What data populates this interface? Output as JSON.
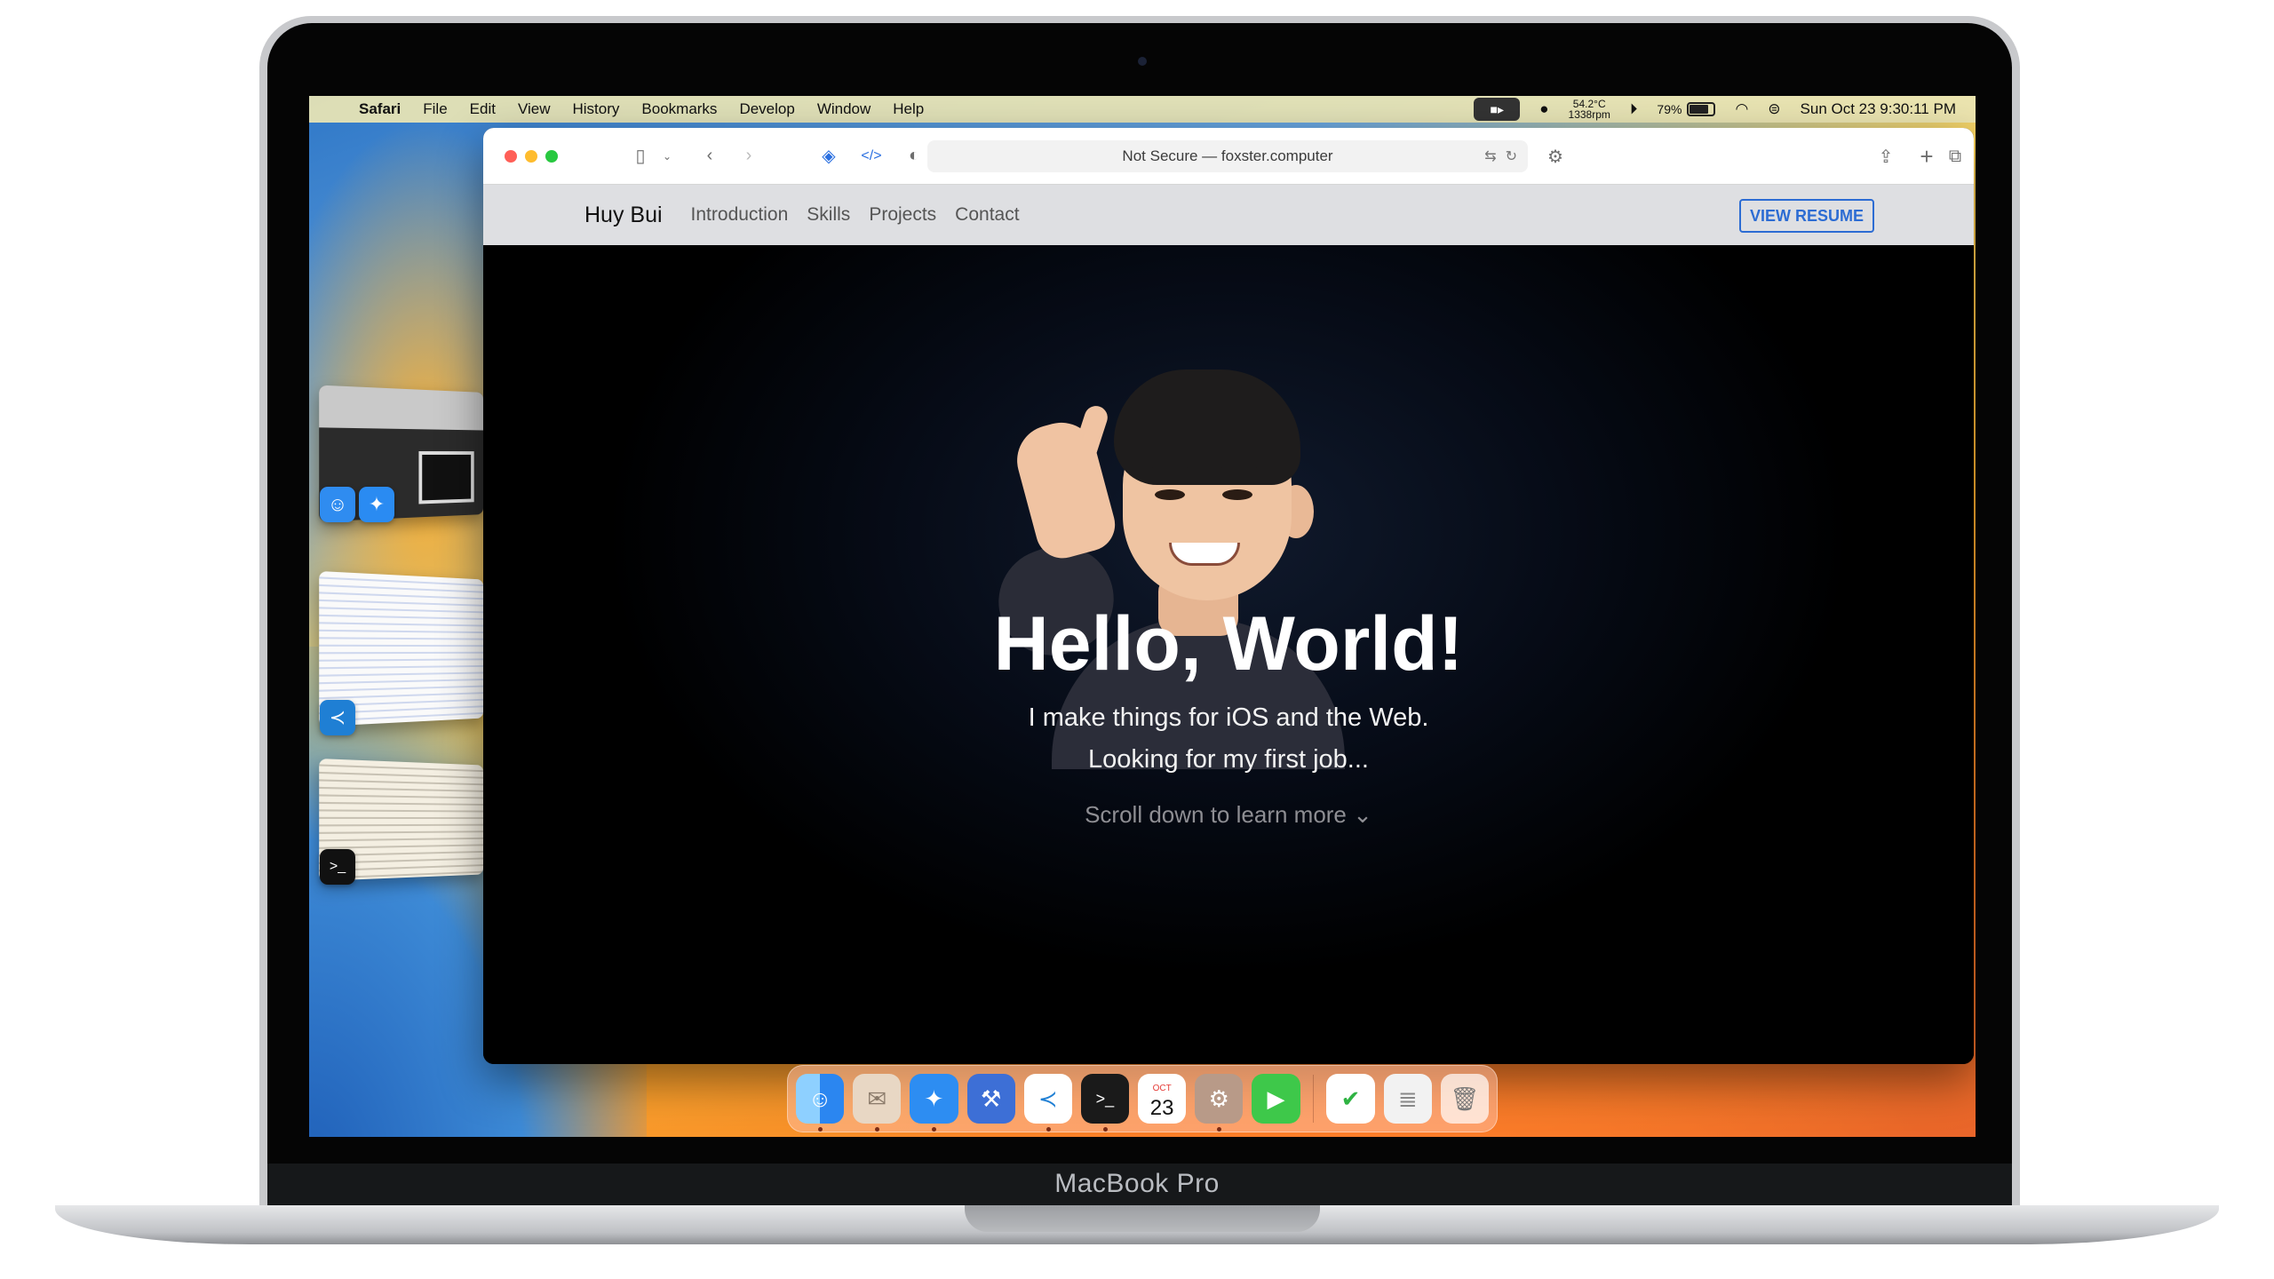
{
  "menubar": {
    "app_name": "Safari",
    "items": [
      "File",
      "Edit",
      "View",
      "History",
      "Bookmarks",
      "Develop",
      "Window",
      "Help"
    ],
    "temp": "54.2°C",
    "rpm": "1338rpm",
    "battery": "79%",
    "battery_level": 0.79,
    "datetime": "Sun Oct 23  9:30:11 PM"
  },
  "browser": {
    "address": "Not Secure — foxster.computer"
  },
  "site": {
    "name": "Huy Bui",
    "nav": [
      "Introduction",
      "Skills",
      "Projects",
      "Contact"
    ],
    "resume_button": "VIEW RESUME",
    "headline": "Hello, World!",
    "tagline_1": "I make things for iOS and the Web.",
    "tagline_2": "Looking for my first job...",
    "scroll_hint": "Scroll down to learn more ⌄"
  },
  "dock": {
    "calendar_month": "OCT",
    "calendar_day": "23"
  },
  "device": {
    "label": "MacBook Pro"
  },
  "colors": {
    "accent": "#2c6cd3",
    "hero_bg": "#000000",
    "nav_bg": "#dedfe2"
  }
}
